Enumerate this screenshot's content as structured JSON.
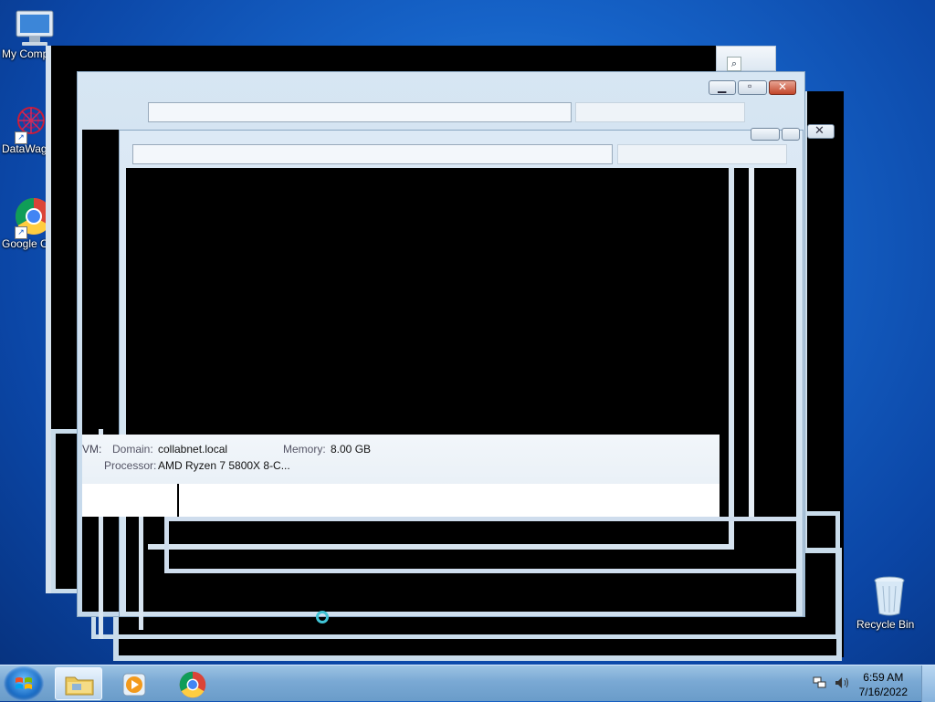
{
  "desktop": {
    "icons": [
      {
        "label": "My Comp",
        "icon": "computer-icon"
      },
      {
        "label": "DataWag",
        "icon": "datawag-icon"
      },
      {
        "label": "Google C",
        "icon": "chrome-icon"
      },
      {
        "label": "Recycle Bin",
        "icon": "recycle-bin-icon"
      }
    ]
  },
  "system_info": {
    "domain_label": "Domain:",
    "domain_value": "collabnet.local",
    "memory_label": "Memory:",
    "memory_value": "8.00 GB",
    "processor_label": "Processor:",
    "processor_value": "AMD Ryzen 7 5800X 8-C...",
    "fragment": "VM:"
  },
  "taskbar": {
    "items": [
      {
        "name": "windows-explorer",
        "icon": "folder-icon",
        "active": true
      },
      {
        "name": "media-player",
        "icon": "media-player-icon",
        "active": false
      },
      {
        "name": "chrome",
        "icon": "chrome-icon",
        "active": false
      }
    ],
    "time": "6:59 AM",
    "date": "7/16/2022"
  },
  "colors": {
    "accent": "#1663c8",
    "frame": "#c9dceb"
  }
}
